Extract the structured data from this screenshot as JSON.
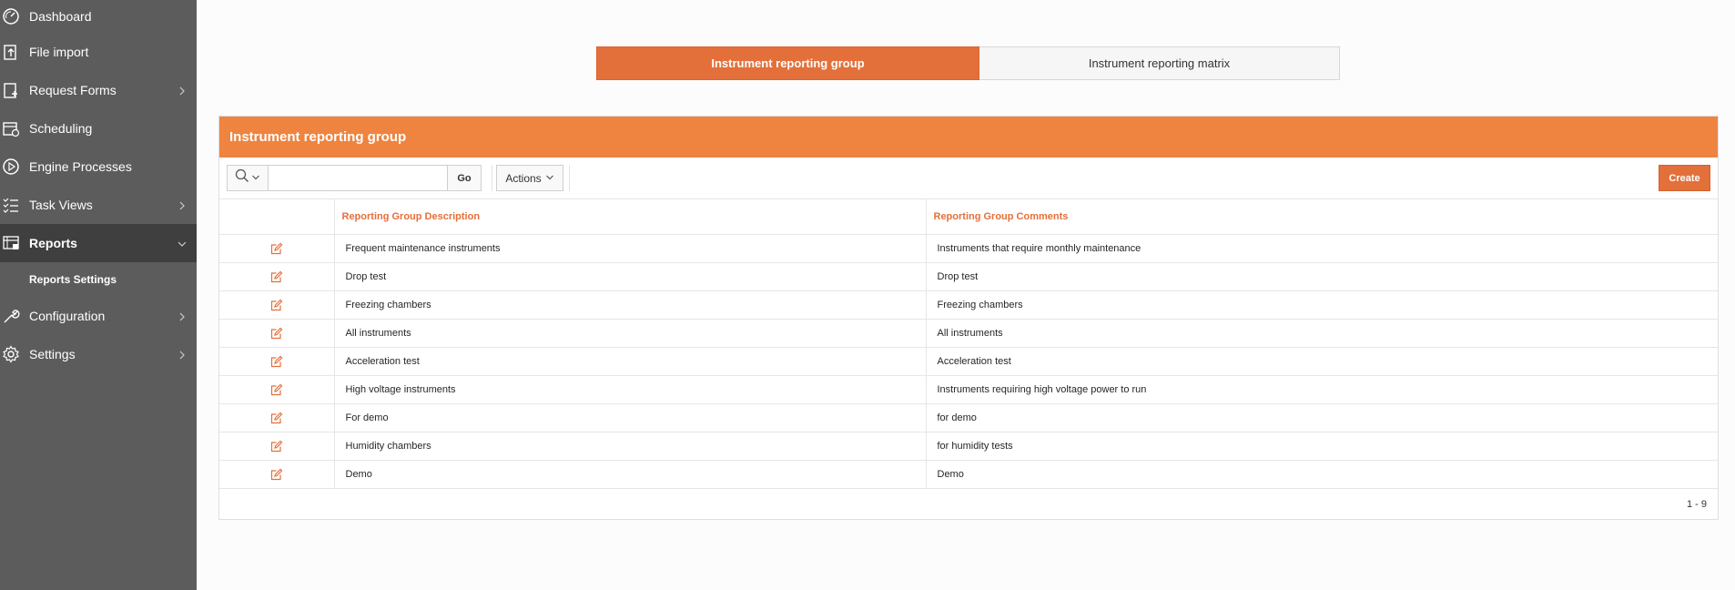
{
  "sidebar": {
    "items": [
      {
        "label": "Dashboard",
        "icon": "dashboard-icon",
        "chevron": false
      },
      {
        "label": "File import",
        "icon": "file-import-icon",
        "chevron": false
      },
      {
        "label": "Request Forms",
        "icon": "request-forms-icon",
        "chevron": true
      },
      {
        "label": "Scheduling",
        "icon": "calendar-clock-icon",
        "chevron": false
      },
      {
        "label": "Engine Processes",
        "icon": "play-circle-icon",
        "chevron": false
      },
      {
        "label": "Task Views",
        "icon": "task-list-icon",
        "chevron": true
      },
      {
        "label": "Reports",
        "icon": "reports-icon",
        "chevron": true,
        "expanded": true,
        "active": true
      },
      {
        "label": "Configuration",
        "icon": "wrench-icon",
        "chevron": true
      },
      {
        "label": "Settings",
        "icon": "gear-icon",
        "chevron": true
      }
    ],
    "sub_item": "Reports Settings"
  },
  "tabs": [
    {
      "label": "Instrument reporting group",
      "active": true
    },
    {
      "label": "Instrument reporting matrix",
      "active": false
    }
  ],
  "region": {
    "title": "Instrument reporting group",
    "toolbar": {
      "search_value": "",
      "go_label": "Go",
      "actions_label": "Actions",
      "create_label": "Create"
    },
    "columns": [
      "Reporting Group Description",
      "Reporting Group Comments"
    ],
    "rows": [
      {
        "description": "Frequent maintenance instruments",
        "comments": "Instruments that require monthly maintenance"
      },
      {
        "description": "Drop test",
        "comments": "Drop test"
      },
      {
        "description": "Freezing chambers",
        "comments": "Freezing chambers"
      },
      {
        "description": "All instruments",
        "comments": "All instruments"
      },
      {
        "description": "Acceleration test",
        "comments": "Acceleration test"
      },
      {
        "description": "High voltage instruments",
        "comments": "Instruments requiring high voltage power to run"
      },
      {
        "description": "For demo",
        "comments": "for demo"
      },
      {
        "description": "Humidity chambers",
        "comments": "for humidity tests"
      },
      {
        "description": "Demo",
        "comments": "Demo"
      }
    ],
    "pagination": "1 - 9"
  },
  "colors": {
    "accent": "#e3703b",
    "region_header": "#ee8440",
    "sidebar_bg": "#5c5c5c",
    "sidebar_active": "#3f3f3f"
  }
}
